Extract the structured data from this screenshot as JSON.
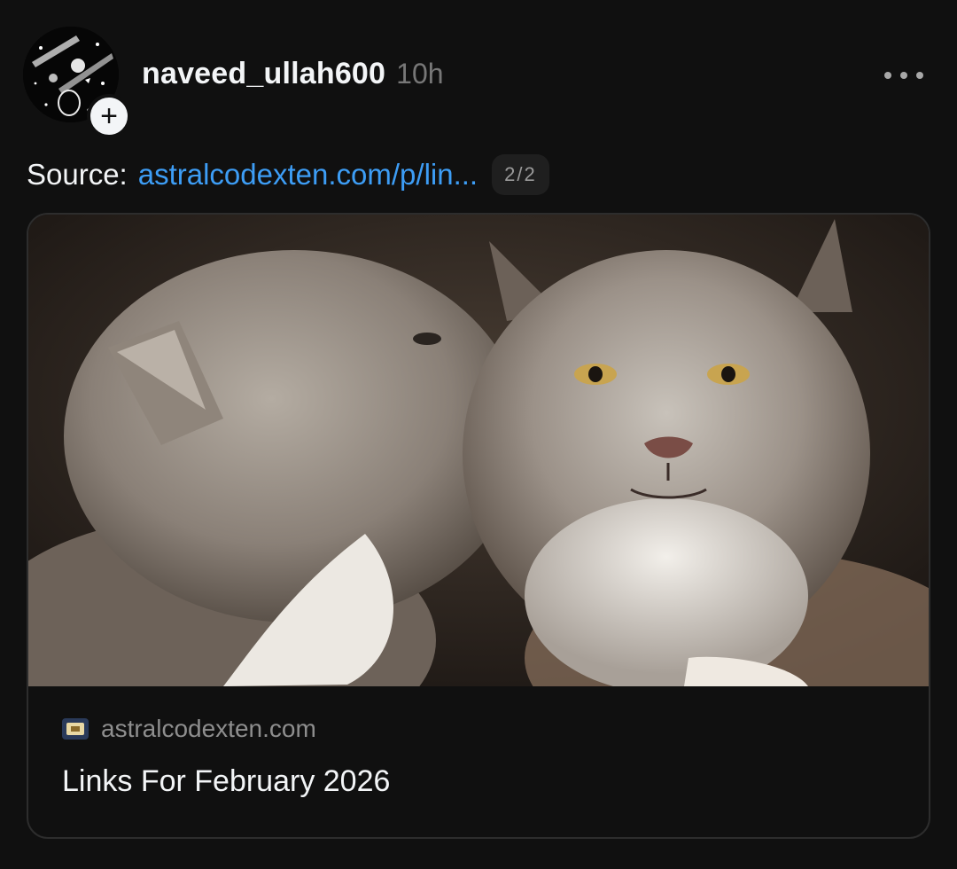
{
  "post": {
    "username": "naveed_ullah600",
    "timestamp": "10h",
    "follow_icon": "plus-icon",
    "more_icon": "more-horizontal-icon",
    "caption_label": "Source:",
    "caption_link": "astralcodexten.com/p/lin...",
    "page_indicator": "2/2"
  },
  "link_card": {
    "image_subject": "lynx-photo",
    "favicon": "favicon-icon",
    "domain": "astralcodexten.com",
    "title": "Links For February 2026"
  },
  "colors": {
    "background": "#101010",
    "text": "#f3f5f7",
    "muted": "#777777",
    "link": "#3d9df5"
  }
}
